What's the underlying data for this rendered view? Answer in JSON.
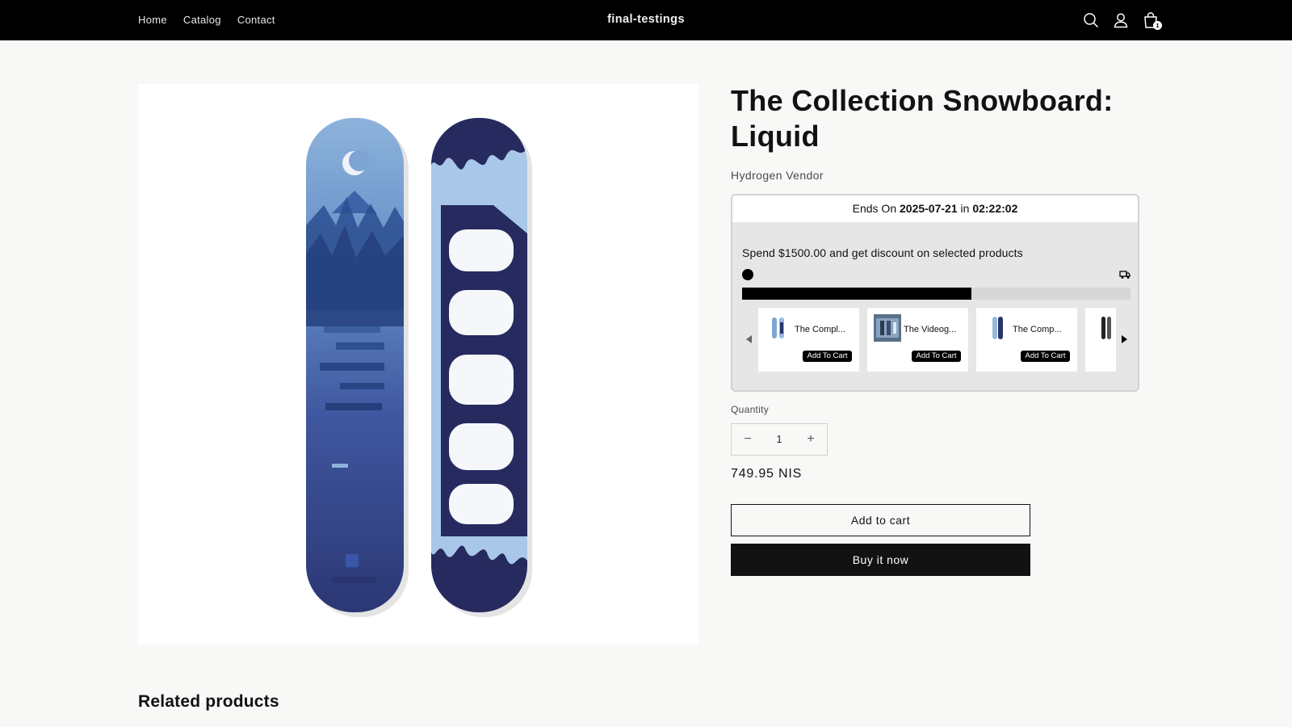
{
  "header": {
    "nav": [
      "Home",
      "Catalog",
      "Contact"
    ],
    "brand": "final-testings",
    "icons": [
      "search-icon",
      "account-icon",
      "cart-icon"
    ],
    "cart_count": "1"
  },
  "product": {
    "title": "The Collection Snowboard: Liquid",
    "vendor": "Hydrogen Vendor",
    "price": "749.95 NIS",
    "quantity_label": "Quantity",
    "quantity": "1",
    "add_to_cart": "Add to cart",
    "buy_now": "Buy it now"
  },
  "discount_widget": {
    "ends_prefix": "Ends On",
    "ends_date": "2025-07-21",
    "ends_in": "in",
    "ends_time": "02:22:02",
    "spend_text": "Spend $1500.00 and get discount on selected products",
    "progress_fraction": 0.59,
    "products": [
      {
        "name": "The Compl...",
        "button": "Add To Cart"
      },
      {
        "name": "The Videog...",
        "button": "Add To Cart"
      },
      {
        "name": "The Comp...",
        "button": "Add To Cart"
      }
    ]
  },
  "related_heading": "Related products",
  "colors": {
    "header_bg": "#000000",
    "page_bg": "#f8f8f7",
    "board_light": "#8fb0d6",
    "board_dark": "#2a2f66"
  }
}
